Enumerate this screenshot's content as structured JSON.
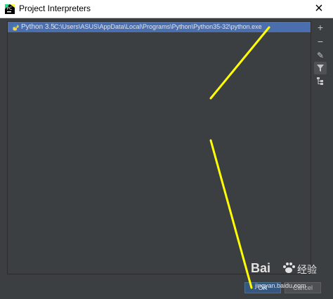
{
  "window": {
    "title": "Project Interpreters",
    "close_glyph": "×"
  },
  "interpreters": [
    {
      "name": "Python 3.5",
      "path": "C:\\Users\\ASUS\\AppData\\Local\\Programs\\Python\\Python35-32\\python.exe",
      "selected": true,
      "icon": "python-icon"
    }
  ],
  "toolbar": {
    "add": "+",
    "remove": "−",
    "edit": "✎",
    "filter": "⏷",
    "tree": "⊞"
  },
  "buttons": {
    "ok": "OK",
    "cancel": "Cancel"
  },
  "watermark": {
    "brand": "Bai",
    "cn": "经验",
    "url": "jingyan.baidu.com"
  },
  "colors": {
    "selection": "#4b6eaf",
    "annotation_line": "#ffff00",
    "background": "#3c3f41"
  }
}
